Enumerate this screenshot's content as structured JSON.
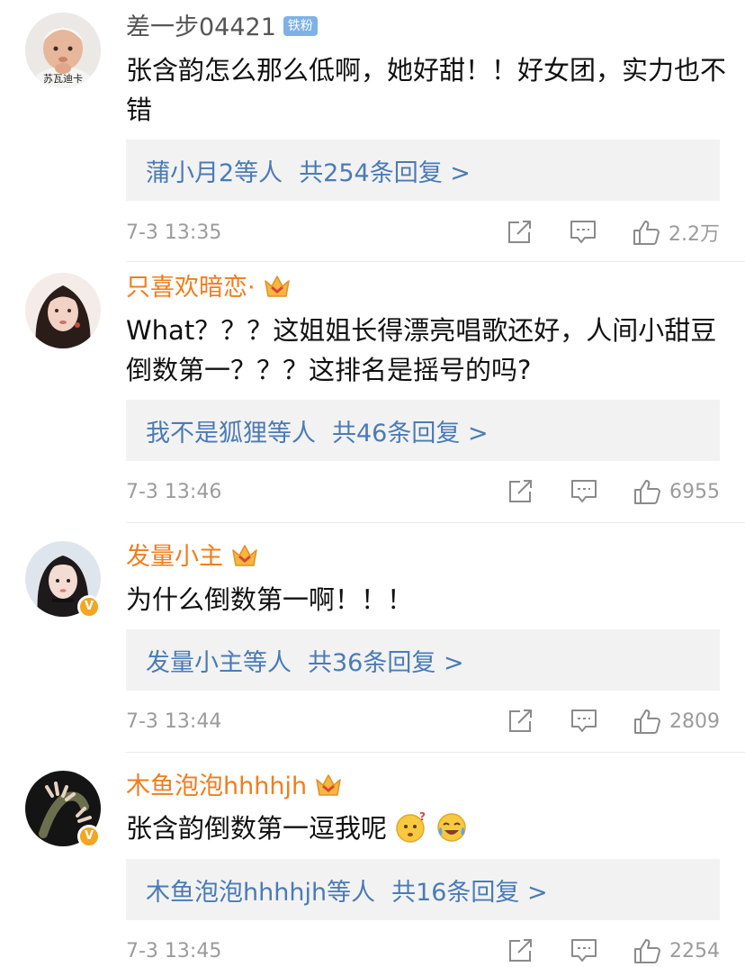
{
  "comments": [
    {
      "username": "差一步04421",
      "badge": "铁粉",
      "avatar_text": "苏瓦迪卡",
      "text": "张含韵怎么那么低啊，她好甜！！好女团，实力也不错",
      "reply_names": "蒲小月2等人",
      "reply_count": "共254条回复 >",
      "time": "7-3 13:35",
      "likes": "2.2万"
    },
    {
      "username": "只喜欢暗恋·",
      "text": "What？？？这姐姐长得漂亮唱歌还好，人间小甜豆倒数第一？？？这排名是摇号的吗?",
      "reply_names": "我不是狐狸等人",
      "reply_count": "共46条回复 >",
      "time": "7-3 13:46",
      "likes": "6955"
    },
    {
      "username": "发量小主",
      "text": "为什么倒数第一啊！！！",
      "reply_names": "发量小主等人",
      "reply_count": "共36条回复 >",
      "time": "7-3 13:44",
      "likes": "2809"
    },
    {
      "username": "木鱼泡泡hhhhjh",
      "text": "张含韵倒数第一逗我呢",
      "reply_names": "木鱼泡泡hhhhjh等人",
      "reply_count": "共16条回复 >",
      "time": "7-3 13:45",
      "likes": "2254"
    }
  ],
  "colors": {
    "vip_name": "#f07d1d",
    "plain_name": "#555555",
    "reply_link": "#4a7bb6",
    "reply_bg": "#f2f2f2",
    "meta": "#9b9b9b",
    "verified": "#f4a521",
    "fan_badge": "#7eb1e6"
  },
  "icons": [
    "share-icon",
    "comment-icon",
    "like-icon",
    "crown-icon",
    "verified-icon",
    "confused-emoji-icon",
    "crying-laugh-emoji-icon"
  ]
}
